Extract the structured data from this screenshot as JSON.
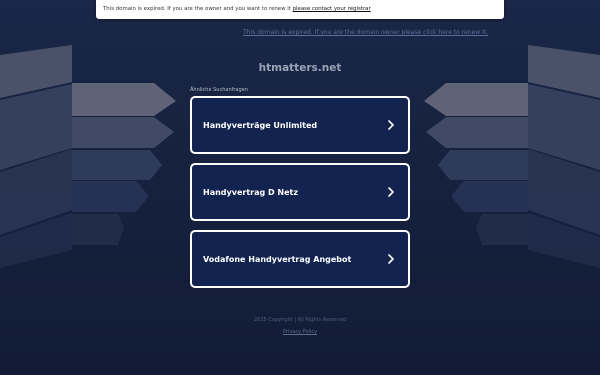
{
  "notice": {
    "text": "This domain is expired. If you are the owner and you want to renew it",
    "link_label": "please contact your registrar"
  },
  "sub_notice": "This domain is expired. If you are the domain owner please click here to renew it.",
  "domain_title": "htmatters.net",
  "related_label": "Ähnliche Suchanfragen",
  "links": [
    {
      "label": "Handyverträge Unlimited"
    },
    {
      "label": "Handyvertrag D Netz"
    },
    {
      "label": "Vodafone Handyvertrag Angebot"
    }
  ],
  "footer": {
    "copyright": "2025 Copyright | All Rights Reserved",
    "privacy_label": "Privacy Policy"
  },
  "colors": {
    "background": "#121d36",
    "card_fill": "#132350",
    "card_border": "#ffffff"
  },
  "icons": {
    "link_arrow": "chevron-right-icon"
  }
}
